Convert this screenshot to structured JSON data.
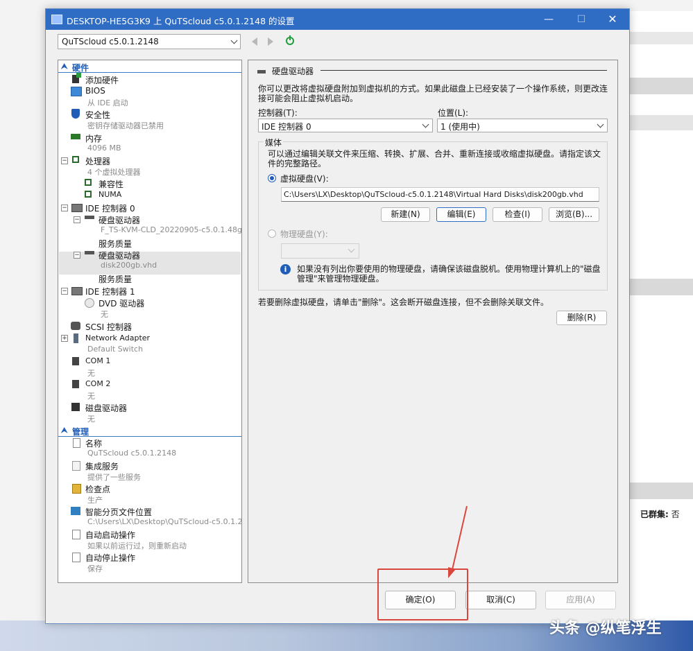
{
  "window": {
    "title": "DESKTOP-HE5G3K9 上 QuTScloud c5.0.1.2148 的设置",
    "min": "—",
    "max": "☐",
    "close": "✕"
  },
  "toolbar": {
    "vm_select": "QuTScloud c5.0.1.2148"
  },
  "tree": {
    "hardware_section": "硬件",
    "management_section": "管理",
    "items": {
      "add_hardware": "添加硬件",
      "bios": "BIOS",
      "bios_sub": "从 IDE 启动",
      "security": "安全性",
      "security_sub": "密钥存储驱动器已禁用",
      "memory": "内存",
      "memory_sub": "4096 MB",
      "processor": "处理器",
      "processor_sub": "4 个虚拟处理器",
      "compat": "兼容性",
      "numa": "NUMA",
      "ide0": "IDE 控制器 0",
      "hdd1": "硬盘驱动器",
      "hdd1_sub": "F_TS-KVM-CLD_20220905-c5.0.1.48g....",
      "qos1": "服务质量",
      "hdd2": "硬盘驱动器",
      "hdd2_sub": "disk200gb.vhd",
      "qos2": "服务质量",
      "ide1": "IDE 控制器 1",
      "dvd": "DVD 驱动器",
      "dvd_sub": "无",
      "scsi": "SCSI 控制器",
      "net": "Network Adapter",
      "net_sub": "Default Switch",
      "com1": "COM 1",
      "com1_sub": "无",
      "com2": "COM 2",
      "com2_sub": "无",
      "floppy": "磁盘驱动器",
      "floppy_sub": "无",
      "name": "名称",
      "name_sub": "QuTScloud c5.0.1.2148",
      "integration": "集成服务",
      "integration_sub": "提供了一些服务",
      "checkpoint": "检查点",
      "checkpoint_sub": "生产",
      "paging": "智能分页文件位置",
      "paging_sub": "C:\\Users\\LX\\Desktop\\QuTScloud-c5.0.1.2...",
      "autostart": "自动启动操作",
      "autostart_sub": "如果以前运行过，则重新启动",
      "autostop": "自动停止操作",
      "autostop_sub": "保存"
    }
  },
  "detail": {
    "header": "硬盘驱动器",
    "description": "你可以更改将虚拟硬盘附加到虚拟机的方式。如果此磁盘上已经安装了一个操作系统，则更改连接可能会阻止虚拟机启动。",
    "controller_label": "控制器(T):",
    "controller_value": "IDE 控制器 0",
    "position_label": "位置(L):",
    "position_value": "1 (使用中)",
    "media_title": "媒体",
    "media_desc": "可以通过编辑关联文件来压缩、转换、扩展、合并、重新连接或收缩虚拟硬盘。请指定该文件的完整路径。",
    "vhd_label": "虚拟硬盘(V):",
    "vhd_path": "C:\\Users\\LX\\Desktop\\QuTScloud-c5.0.1.2148\\Virtual Hard Disks\\disk200gb.vhd",
    "new_btn": "新建(N)",
    "edit_btn": "编辑(E)",
    "inspect_btn": "检查(I)",
    "browse_btn": "浏览(B)...",
    "phys_label": "物理硬盘(Y):",
    "info_text": "如果没有列出你要使用的物理硬盘，请确保该磁盘脱机。使用物理计算机上的\"磁盘管理\"来管理物理硬盘。",
    "remove_desc": "若要删除虚拟硬盘，请单击\"删除\"。这会断开磁盘连接，但不会删除关联文件。",
    "remove_btn": "删除(R)"
  },
  "footer": {
    "ok": "确定(O)",
    "cancel": "取消(C)",
    "apply": "应用(A)"
  },
  "background": {
    "clustered_label": "已群集:",
    "clustered_value": "否"
  },
  "watermark": "头条 @纵笔浮生",
  "colors": {
    "titlebar": "#2f6cc4",
    "accent": "#1f5db8",
    "annotation": "#d9463e"
  }
}
